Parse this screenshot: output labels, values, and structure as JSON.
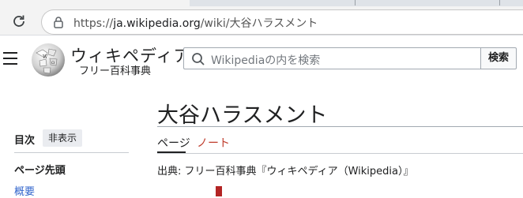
{
  "browser": {
    "url_scheme": "https://",
    "url_host": "ja.wikipedia.org",
    "url_path": "/wiki/大谷ハラスメント",
    "reload_icon": "reload-icon",
    "lock_icon": "lock-icon"
  },
  "header": {
    "menu_icon": "hamburger-menu-icon",
    "logo_icon": "wikipedia-globe-icon",
    "wordmark": "ウィキペディア",
    "tagline": "フリー百科事典",
    "search_placeholder": "Wikipediaの内を検索",
    "search_icon": "search-icon",
    "search_button": "検索"
  },
  "toc": {
    "title": "目次",
    "hide_label": "非表示",
    "top_label": "ページ先頭",
    "items": [
      "概要"
    ]
  },
  "article": {
    "title": "大谷ハラスメント",
    "tabs": [
      {
        "label": "ページ"
      },
      {
        "label": "ノート"
      }
    ],
    "from_line": "出典: フリー百科事典『ウィキペディア（Wikipedia）』"
  },
  "colors": {
    "link": "#3366cc",
    "talk_tab": "#bf3c2c",
    "marker": "#b32424"
  }
}
